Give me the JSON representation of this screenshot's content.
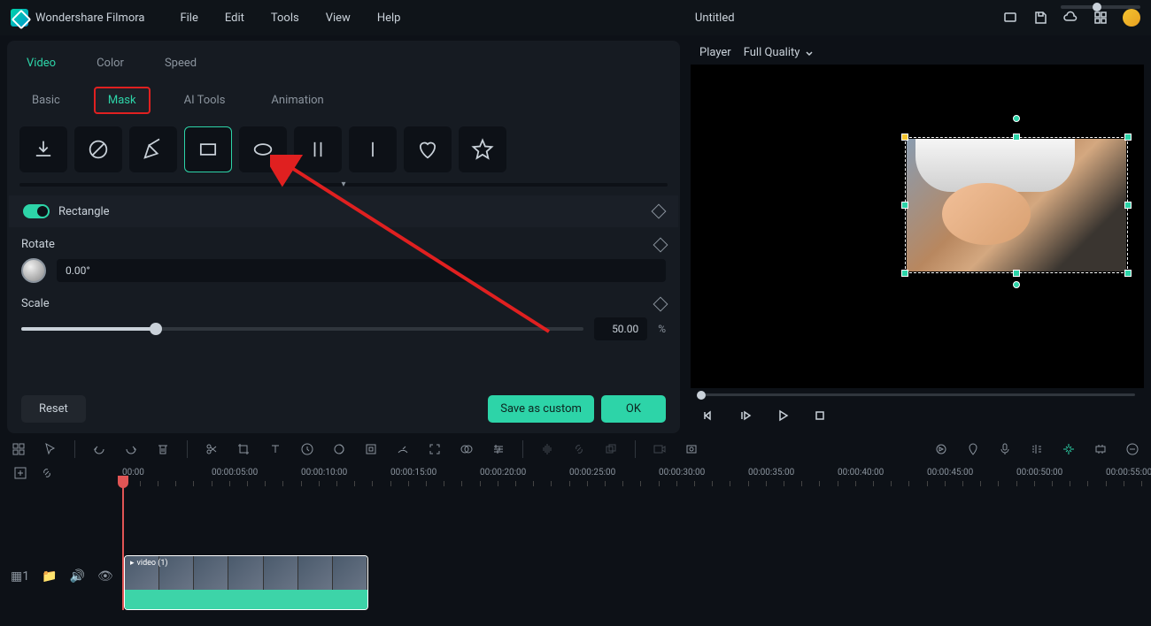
{
  "app": {
    "name": "Wondershare Filmora",
    "title": "Untitled"
  },
  "menu": [
    "File",
    "Edit",
    "Tools",
    "View",
    "Help"
  ],
  "topTabs": [
    "Video",
    "Color",
    "Speed"
  ],
  "topTabActive": 0,
  "subTabs": [
    "Basic",
    "Mask",
    "AI Tools",
    "Animation"
  ],
  "subTabActive": 1,
  "maskShapes": [
    "import",
    "none",
    "pen",
    "rectangle",
    "ellipse",
    "parallel-lines",
    "single-line",
    "heart",
    "star"
  ],
  "maskShapeSelected": 3,
  "section": {
    "label": "Rectangle"
  },
  "rotate": {
    "label": "Rotate",
    "value": "0.00°"
  },
  "scale": {
    "label": "Scale",
    "value": "50.00",
    "unit": "%",
    "percent": 24
  },
  "buttons": {
    "reset": "Reset",
    "save": "Save as custom",
    "ok": "OK"
  },
  "player": {
    "label": "Player",
    "quality": "Full Quality"
  },
  "timeline": {
    "marks": [
      "00:00",
      "00:00:05:00",
      "00:00:10:00",
      "00:00:15:00",
      "00:00:20:00",
      "00:00:25:00",
      "00:00:30:00",
      "00:00:35:00",
      "00:00:40:00",
      "00:00:45:00",
      "00:00:50:00",
      "00:00:55:00"
    ],
    "clipLabel": "video (1)",
    "trackLabel": "1"
  }
}
